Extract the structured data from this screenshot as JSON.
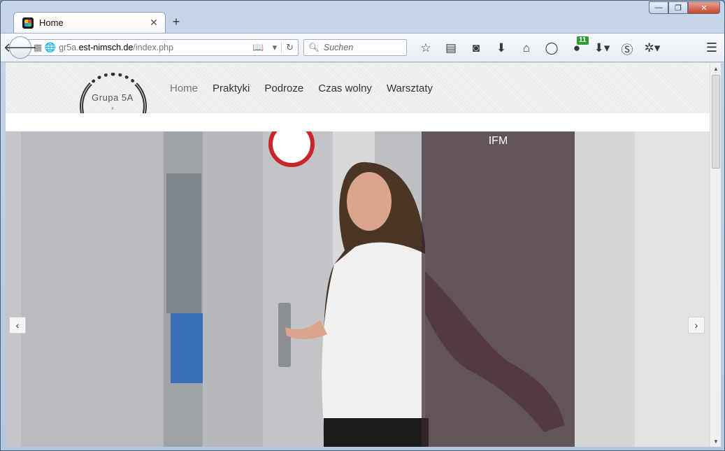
{
  "browser": {
    "tab_title": "Home",
    "tab_close": "✕",
    "new_tab": "+",
    "controls": {
      "minimize": "—",
      "maximize": "❐",
      "close": "✕"
    }
  },
  "navbar": {
    "url": {
      "prefix": "gr5a.",
      "host": "est-nimsch.de",
      "path": "/index.php"
    },
    "search_placeholder": "Suchen",
    "addon_badge": "11"
  },
  "site": {
    "logo_text": "Grupa 5A",
    "logo_sub": "x",
    "menu": [
      {
        "label": "Home",
        "active": true
      },
      {
        "label": "Praktyki"
      },
      {
        "label": "Podroze"
      },
      {
        "label": "Czas wolny"
      },
      {
        "label": "Warsztaty"
      }
    ]
  },
  "slider": {
    "caption": "IFM",
    "prev": "‹",
    "next": "›"
  },
  "icons": {
    "back": "back-arrow-icon",
    "bookmark": "star-icon",
    "home": "home-icon",
    "download": "download-icon",
    "menu": "hamburger-icon"
  }
}
